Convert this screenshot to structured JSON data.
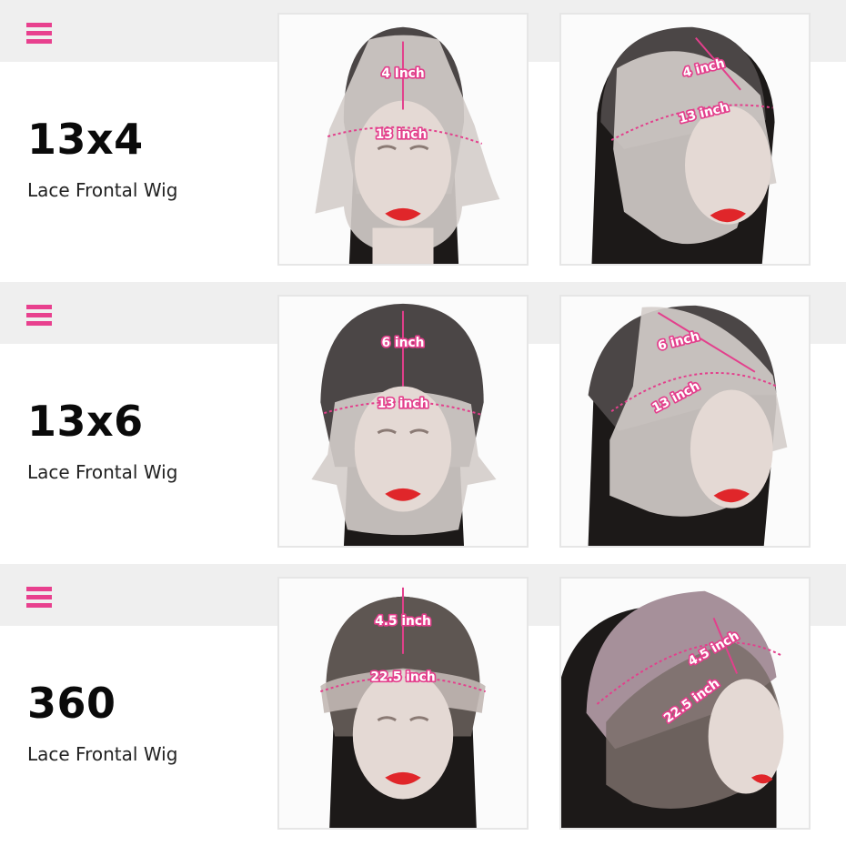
{
  "colors": {
    "accent": "#e8408e",
    "band": "#efefef",
    "lace": "#d4cdca",
    "cap": "#4b4646",
    "hair": "#1c1918"
  },
  "rows": [
    {
      "size": "13x4",
      "kind": "Lace Frontal Wig",
      "front": {
        "depth": "4 Inch",
        "width": "13 inch"
      },
      "side": {
        "depth": "4 inch",
        "width": "13 inch"
      }
    },
    {
      "size": "13x6",
      "kind": "Lace Frontal Wig",
      "front": {
        "depth": "6 inch",
        "width": "13 inch"
      },
      "side": {
        "depth": "6 inch",
        "width": "13 inch"
      }
    },
    {
      "size": "360",
      "kind": "Lace Frontal Wig",
      "front": {
        "depth": "4.5 inch",
        "width": "22.5 inch"
      },
      "side": {
        "depth": "4.5 inch",
        "width": "22.5 inch"
      }
    }
  ]
}
